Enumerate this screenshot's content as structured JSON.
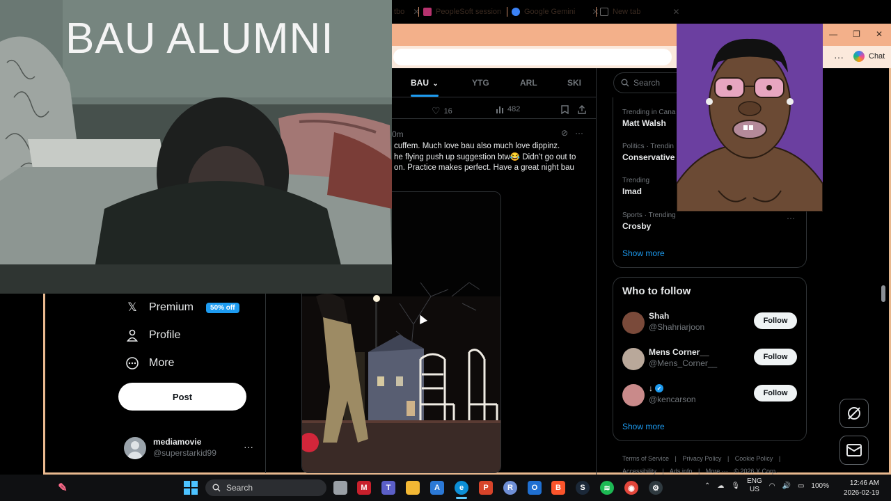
{
  "browser": {
    "tabs": [
      {
        "label": "tbo",
        "color": "#d9534f"
      },
      {
        "label": "PeopleSoft session",
        "color": "#b6326e"
      },
      {
        "label": "Google Gemini",
        "color": "#3b82f6"
      },
      {
        "label": "New tab",
        "color": "#6b6b6b"
      }
    ],
    "copilot_label": "Chat",
    "more_label": "···"
  },
  "feed": {
    "tabs": [
      {
        "label": "BAU",
        "active": true
      },
      {
        "label": "YTG",
        "active": false
      },
      {
        "label": "ARL",
        "active": false
      },
      {
        "label": "SKI",
        "active": false
      }
    ],
    "actions": {
      "likes": "16",
      "views": "482"
    },
    "post": {
      "time": "0m",
      "lines": [
        "cuffem. Much love bau also much love dippinz.",
        "he flying push up suggestion btw😂 Didn't go out to",
        "on. Practice makes perfect. Have a great night bau"
      ]
    }
  },
  "nav": {
    "premium_label": "Premium",
    "premium_badge": "50% off",
    "profile_label": "Profile",
    "more_label": "More",
    "post_button": "Post",
    "account": {
      "name": "mediamovie",
      "handle": "@superstarkid99"
    }
  },
  "right": {
    "search_placeholder": "Search",
    "trends": [
      {
        "category": "Trending in Cana",
        "name": "Matt Walsh"
      },
      {
        "category": "Politics · Trendin",
        "name": "Conservative"
      },
      {
        "category": "Trending",
        "name": "Imad"
      },
      {
        "category": "Sports · Trending",
        "name": "Crosby"
      }
    ],
    "show_more": "Show more",
    "who_to_follow_title": "Who to follow",
    "follow_suggestions": [
      {
        "name": "Shah",
        "handle": "@Shahriarjoon",
        "button": "Follow",
        "verified": false,
        "avatar_color": "#7a4a3a"
      },
      {
        "name": "Mens Corner__",
        "handle": "@Mens_Corner__",
        "button": "Follow",
        "verified": false,
        "avatar_color": "#b9a89a"
      },
      {
        "name": "↓",
        "handle": "@kencarson",
        "button": "Follow",
        "verified": true,
        "avatar_color": "#c98a8a"
      }
    ],
    "show_more_2": "Show more",
    "footer_links": [
      "Terms of Service",
      "|",
      "Privacy Policy",
      "|",
      "Cookie Policy",
      "|",
      "Accessibility",
      "|",
      "Ads info",
      "|",
      "More ···",
      "© 2026 X Corp."
    ]
  },
  "webcam": {
    "overlay_text": "BAU ALUMNI"
  },
  "taskbar": {
    "search_label": "Search",
    "lang_top": "ENG",
    "lang_bottom": "US",
    "battery": "100%",
    "time": "12:46 AM",
    "date": "2026-02-19"
  },
  "colors": {
    "accent": "#1d9bf0",
    "tabbar": "#f3b08a",
    "window_border": "#e9b98f"
  }
}
